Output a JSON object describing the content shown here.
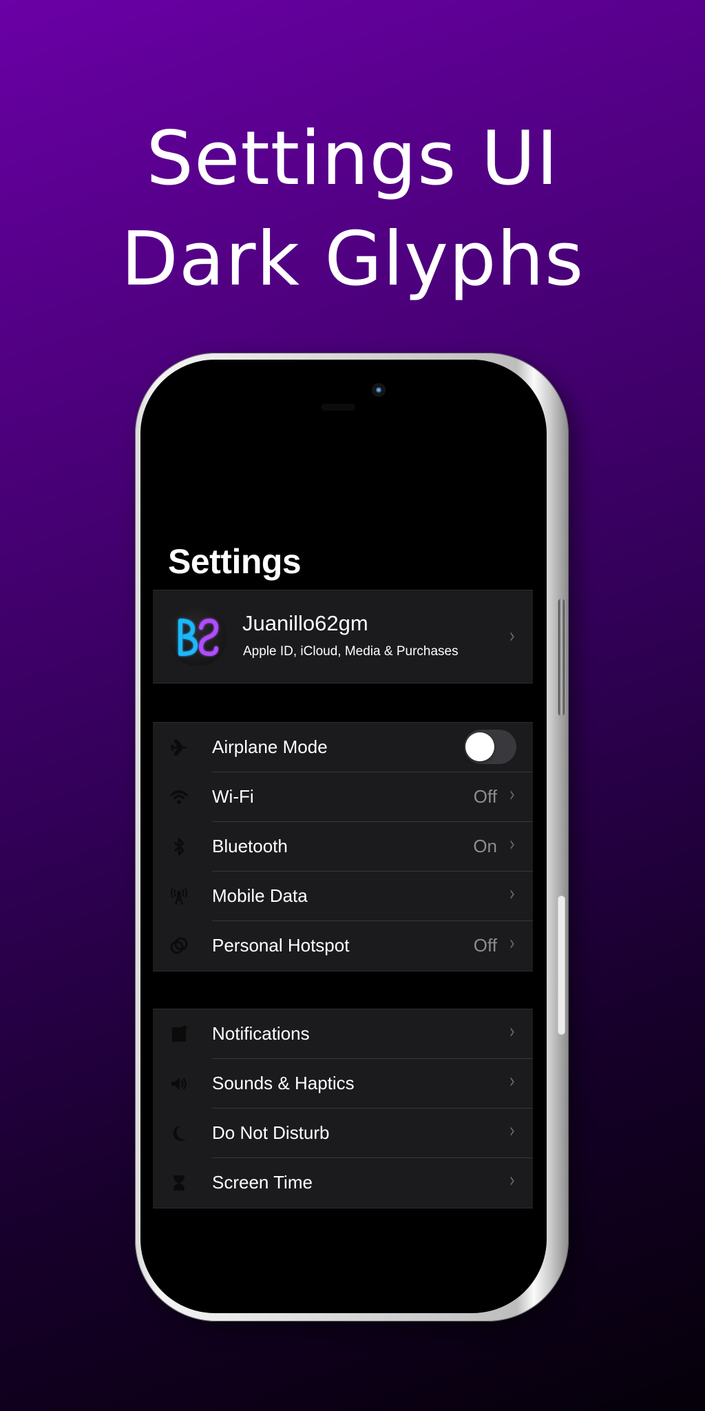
{
  "promo": {
    "headline_line1": "Settings UI",
    "headline_line2": "Dark Glyphs",
    "background_top_color": "#6a00a6",
    "background_bottom_color": "#050009"
  },
  "screen": {
    "title": "Settings",
    "profile": {
      "avatar_initials_glyph": "BS-neon-logo",
      "name": "Juanillo62gm",
      "subtitle": "Apple ID, iCloud, Media & Purchases"
    },
    "group1": [
      {
        "label": "Airplane Mode",
        "icon": "airplane-icon",
        "control": "toggle",
        "toggle_on": false
      },
      {
        "label": "Wi-Fi",
        "icon": "wifi-icon",
        "value": "Off"
      },
      {
        "label": "Bluetooth",
        "icon": "bluetooth-icon",
        "value": "On"
      },
      {
        "label": "Mobile Data",
        "icon": "antenna-icon",
        "value": ""
      },
      {
        "label": "Personal Hotspot",
        "icon": "hotspot-icon",
        "value": "Off"
      }
    ],
    "group2": [
      {
        "label": "Notifications",
        "icon": "notifications-icon"
      },
      {
        "label": "Sounds & Haptics",
        "icon": "speaker-icon"
      },
      {
        "label": "Do Not Disturb",
        "icon": "moon-icon"
      },
      {
        "label": "Screen Time",
        "icon": "hourglass-icon"
      }
    ],
    "chevron_glyph": "›"
  }
}
